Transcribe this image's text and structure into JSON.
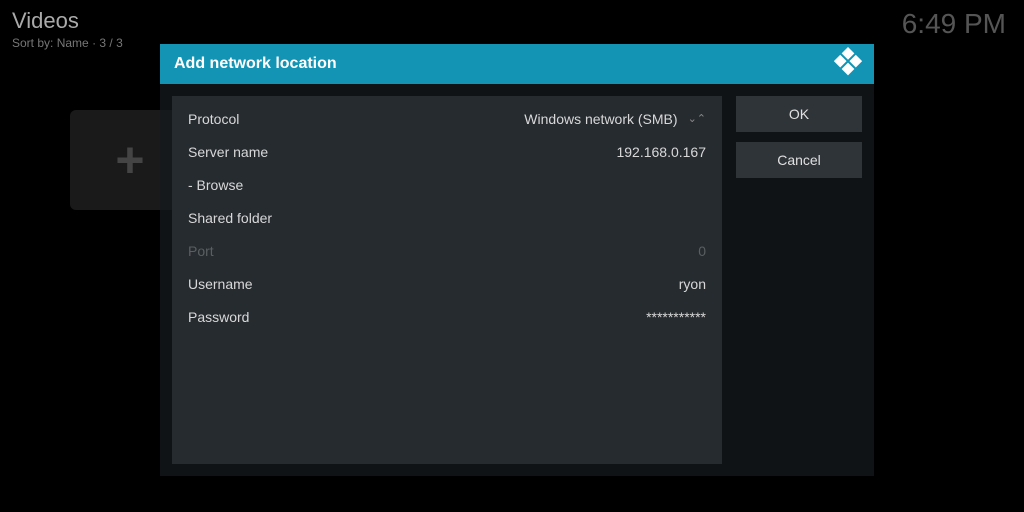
{
  "background": {
    "title": "Videos",
    "sort_prefix": "Sort by:",
    "sort_value": "Name",
    "count": "3 / 3"
  },
  "clock": "6:49 PM",
  "dialog": {
    "title": "Add network location",
    "form": {
      "protocol_label": "Protocol",
      "protocol_value": "Windows network (SMB)",
      "server_label": "Server name",
      "server_value": "192.168.0.167",
      "browse_label": "- Browse",
      "shared_folder_label": "Shared folder",
      "shared_folder_value": "",
      "port_label": "Port",
      "port_value": "0",
      "username_label": "Username",
      "username_value": "ryon",
      "password_label": "Password",
      "password_value": "***********"
    },
    "buttons": {
      "ok": "OK",
      "cancel": "Cancel"
    }
  }
}
